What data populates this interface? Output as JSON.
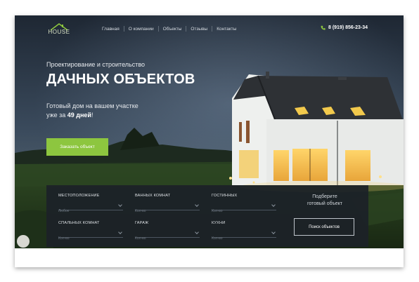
{
  "logo": {
    "text": "HOUSE"
  },
  "nav": {
    "items": [
      {
        "label": "Главная"
      },
      {
        "label": "О компании"
      },
      {
        "label": "Объекты"
      },
      {
        "label": "Отзывы"
      },
      {
        "label": "Контакты"
      }
    ]
  },
  "header": {
    "phone": "8 (919) 856-23-34",
    "phone_icon": "phone-icon"
  },
  "hero": {
    "subtitle": "Проектирование и строительство",
    "title": "ДАЧНЫХ ОБЪЕКТОВ",
    "line1": "Готовый дом на вашем участке",
    "line2_prefix": "уже за ",
    "line2_bold": "49 дней",
    "line2_suffix": "!",
    "cta_label": "Заказать объект"
  },
  "filters": {
    "fields": [
      {
        "label": "МЕСТОПОЛОЖЕНИЕ",
        "value": "Любое"
      },
      {
        "label": "ВАННЫХ КОМНАТ",
        "value": "Кол-во"
      },
      {
        "label": "ГОСТИННЫХ",
        "value": "Кол-во"
      },
      {
        "label": "СПАЛЬНЫХ КОМНАТ",
        "value": "Кол-во"
      },
      {
        "label": "ГАРАЖ",
        "value": "Кол-во"
      },
      {
        "label": "КУХНИ",
        "value": "Кол-во"
      }
    ],
    "find_line1": "Подберите",
    "find_line2": "готовый объект",
    "search_label": "Поиск объектов"
  },
  "colors": {
    "accent": "#8dc63f",
    "panel": "#1c2128",
    "sky": "#2b3a4c"
  }
}
